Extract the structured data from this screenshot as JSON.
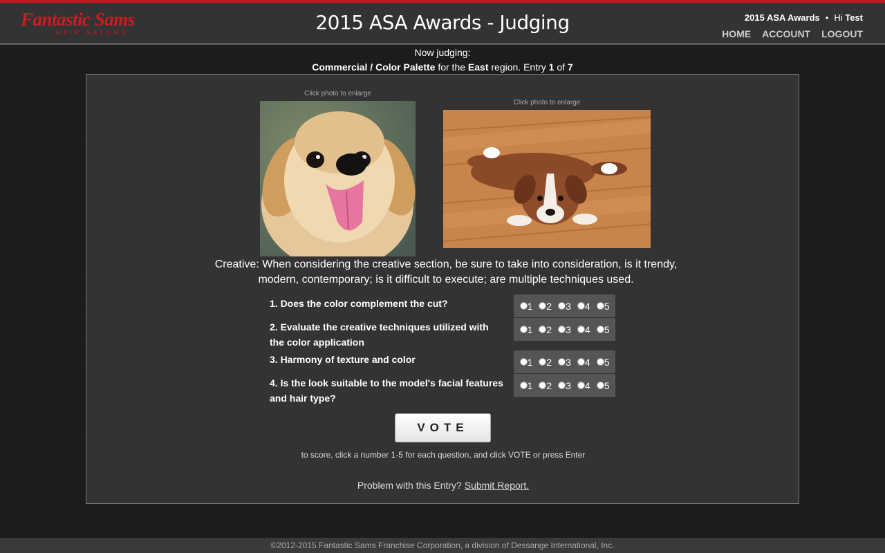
{
  "header": {
    "logo_main": "Fantastic Sams",
    "logo_sub": "HAIR SALONS",
    "title": "2015 ASA Awards - Judging",
    "contest": "2015 ASA Awards",
    "separator": "•",
    "greeting": "Hi",
    "user": "Test",
    "nav": {
      "home": "HOME",
      "account": "ACCOUNT",
      "logout": "LOGOUT"
    }
  },
  "judging": {
    "label": "Now judging:",
    "category": "Commercial / Color Palette",
    "for_the": "for the",
    "region": "East",
    "region_word": "region. Entry",
    "entry_current": "1",
    "of_word": "of",
    "entry_total": "7"
  },
  "photos": {
    "caption": "Click photo to enlarge"
  },
  "creative_text": "Creative: When considering the creative section, be sure to take into consideration, is it trendy, modern, contemporary; is it difficult to execute; are multiple techniques used.",
  "questions": [
    "1. Does the color complement the cut?",
    "2. Evaluate the creative techniques utilized with the color application",
    "3. Harmony of texture and color",
    "4. Is the look suitable to the model's facial features and hair type?"
  ],
  "rating_options": [
    "1",
    "2",
    "3",
    "4",
    "5"
  ],
  "vote_label": "VOTE",
  "hint": "to score, click a number 1-5 for each question, and click VOTE or press Enter",
  "report": {
    "text": "Problem with this Entry?",
    "link": "Submit Report."
  },
  "footer": "©2012-2015 Fantastic Sams Franchise Corporation, a division of Dessange International, Inc.",
  "colors": {
    "brand_red": "#d01a22",
    "panel": "#333333",
    "rating_bg": "#555555"
  }
}
